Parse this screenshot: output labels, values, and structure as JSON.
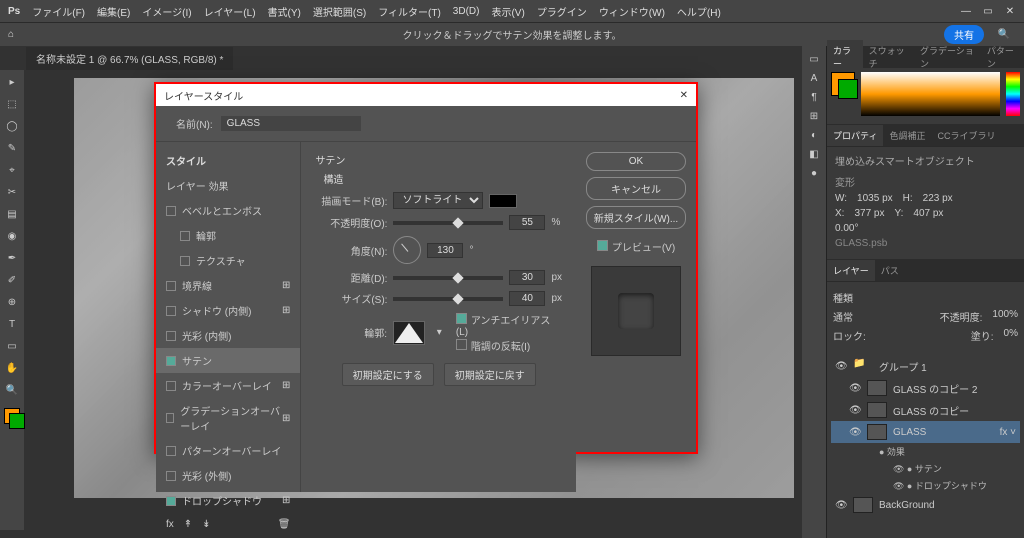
{
  "menubar": {
    "logo": "Ps",
    "items": [
      "ファイル(F)",
      "編集(E)",
      "イメージ(I)",
      "レイヤー(L)",
      "書式(Y)",
      "選択範囲(S)",
      "フィルター(T)",
      "3D(D)",
      "表示(V)",
      "プラグイン",
      "ウィンドウ(W)",
      "ヘルプ(H)"
    ]
  },
  "infobar": {
    "text": "クリック＆ドラッグでサテン効果を調整します。",
    "share": "共有",
    "home": "⌂"
  },
  "tab": {
    "title": "名称未設定 1 @ 66.7% (GLASS, RGB/8) *"
  },
  "tools": [
    "▸",
    "⬚",
    "◯",
    "✎",
    "⌖",
    "✂",
    "▤",
    "◉",
    "✒",
    "✐",
    "⊕",
    "T",
    "▭",
    "✋",
    "🔍"
  ],
  "iconcol": [
    "▭",
    "A",
    "¶",
    "⊞",
    "◐",
    "◧",
    "●"
  ],
  "panels": {
    "color": {
      "tabs": [
        "カラー",
        "スウォッチ",
        "グラデーション",
        "パターン"
      ]
    },
    "props": {
      "tabs": [
        "プロパティ",
        "色調補正",
        "CCライブラリ"
      ],
      "smart": "埋め込みスマートオブジェクト",
      "dim_header": "変形",
      "w_label": "W:",
      "w": "1035 px",
      "h_label": "H:",
      "h": "223 px",
      "x_label": "X:",
      "x": "377 px",
      "y_label": "Y:",
      "y": "407 px",
      "angle": "0.00°",
      "file": "GLASS.psb"
    },
    "layers": {
      "tabs": [
        "レイヤー",
        "パス"
      ],
      "kind": "種類",
      "mode": "通常",
      "opacity_label": "不透明度:",
      "opacity": "100%",
      "lock": "ロック:",
      "fill_label": "塗り:",
      "fill": "0%",
      "items": [
        {
          "name": "グループ 1",
          "type": "group"
        },
        {
          "name": "GLASS のコピー 2",
          "type": "smart",
          "indent": 1
        },
        {
          "name": "GLASS のコピー",
          "type": "smart",
          "indent": 1
        },
        {
          "name": "GLASS",
          "type": "smart",
          "indent": 1,
          "sel": true,
          "fx": true
        },
        {
          "name": "効果",
          "type": "fx",
          "indent": 2
        },
        {
          "name": "サテン",
          "type": "fx",
          "indent": 3,
          "eye": true
        },
        {
          "name": "ドロップシャドウ",
          "type": "fx",
          "indent": 3,
          "eye": true
        },
        {
          "name": "BackGround",
          "type": "layer"
        }
      ]
    }
  },
  "dialog": {
    "title": "レイヤースタイル",
    "name_label": "名前(N):",
    "name": "GLASS",
    "ok": "OK",
    "cancel": "キャンセル",
    "newstyle": "新規スタイル(W)...",
    "preview": "プレビュー(V)",
    "styles_header": "スタイル",
    "effects_header": "レイヤー 効果",
    "styles": [
      {
        "label": "ベベルとエンボス",
        "chk": false
      },
      {
        "label": "輪郭",
        "chk": false,
        "sub": true
      },
      {
        "label": "テクスチャ",
        "chk": false,
        "sub": true
      },
      {
        "label": "境界線",
        "chk": false,
        "plus": true
      },
      {
        "label": "シャドウ (内側)",
        "chk": false,
        "plus": true
      },
      {
        "label": "光彩 (内側)",
        "chk": false
      },
      {
        "label": "サテン",
        "chk": true,
        "sel": true
      },
      {
        "label": "カラーオーバーレイ",
        "chk": false,
        "plus": true
      },
      {
        "label": "グラデーションオーバーレイ",
        "chk": false,
        "plus": true
      },
      {
        "label": "パターンオーバーレイ",
        "chk": false
      },
      {
        "label": "光彩 (外側)",
        "chk": false
      },
      {
        "label": "ドロップシャドウ",
        "chk": true,
        "plus": true
      }
    ],
    "satin": {
      "section": "サテン",
      "sub": "構造",
      "blend_label": "描画モード(B):",
      "blend": "ソフトライト",
      "opacity_label": "不透明度(O):",
      "opacity": "55",
      "opacity_unit": "%",
      "angle_label": "角度(N):",
      "angle": "130",
      "angle_unit": "°",
      "distance_label": "距離(D):",
      "distance": "30",
      "distance_unit": "px",
      "size_label": "サイズ(S):",
      "size": "40",
      "size_unit": "px",
      "contour_label": "輪郭:",
      "antialias": "アンチエイリアス(L)",
      "invert": "階調の反転(I)",
      "default": "初期設定にする",
      "reset": "初期設定に戻す"
    }
  }
}
